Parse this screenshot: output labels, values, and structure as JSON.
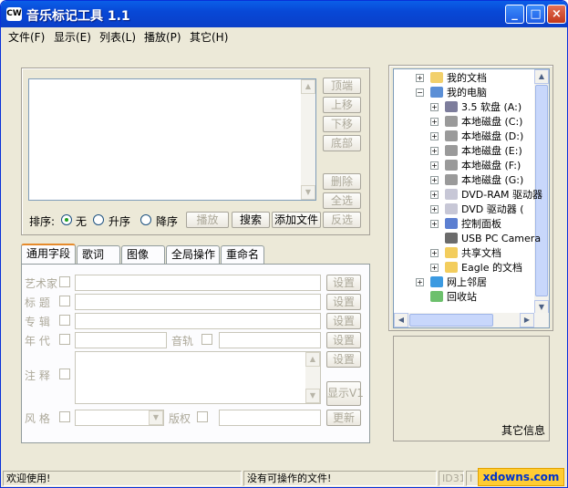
{
  "window": {
    "title": "音乐标记工具 1.1",
    "app_icon_text": "CW"
  },
  "titlebar_buttons": {
    "minimize": "_",
    "maximize": "□",
    "close": "×"
  },
  "menu": [
    "文件(F)",
    "显示(E)",
    "列表(L)",
    "播放(P)",
    "其它(H)"
  ],
  "list_buttons": {
    "top": "顶端",
    "up": "上移",
    "down": "下移",
    "bottom": "底部",
    "delete": "删除",
    "select_all": "全选",
    "invert": "反选"
  },
  "sort": {
    "label": "排序:",
    "none": "无",
    "asc": "升序",
    "desc": "降序",
    "selected": "无"
  },
  "action_buttons": {
    "play": "播放",
    "search": "搜索",
    "add_file": "添加文件"
  },
  "tabs": [
    "通用字段",
    "歌词",
    "图像",
    "全局操作",
    "重命名"
  ],
  "fields": {
    "artist": "艺术家",
    "title": "标 题",
    "album": "专 辑",
    "year": "年 代",
    "track": "音轨",
    "comment": "注 释",
    "genre": "风 格",
    "copyright": "版权"
  },
  "field_buttons": {
    "set": "设置",
    "show": "显示V1",
    "update": "更新"
  },
  "tree": [
    {
      "label": "我的文档",
      "level": 0,
      "expander": "+",
      "icon": "folder-docs-icon"
    },
    {
      "label": "我的电脑",
      "level": 0,
      "expander": "-",
      "icon": "computer-icon"
    },
    {
      "label": "3.5 软盘 (A:)",
      "level": 1,
      "expander": "+",
      "icon": "floppy-icon"
    },
    {
      "label": "本地磁盘 (C:)",
      "level": 1,
      "expander": "+",
      "icon": "disk-icon"
    },
    {
      "label": "本地磁盘 (D:)",
      "level": 1,
      "expander": "+",
      "icon": "disk-icon"
    },
    {
      "label": "本地磁盘 (E:)",
      "level": 1,
      "expander": "+",
      "icon": "disk-icon"
    },
    {
      "label": "本地磁盘 (F:)",
      "level": 1,
      "expander": "+",
      "icon": "disk-icon"
    },
    {
      "label": "本地磁盘 (G:)",
      "level": 1,
      "expander": "+",
      "icon": "disk-icon"
    },
    {
      "label": "DVD-RAM 驱动器",
      "level": 1,
      "expander": "+",
      "icon": "dvd-icon"
    },
    {
      "label": "DVD 驱动器 (",
      "level": 1,
      "expander": "+",
      "icon": "dvd-icon"
    },
    {
      "label": "控制面板",
      "level": 1,
      "expander": "+",
      "icon": "control-panel-icon"
    },
    {
      "label": "USB PC Camera",
      "level": 1,
      "expander": "",
      "icon": "camera-icon"
    },
    {
      "label": "共享文档",
      "level": 1,
      "expander": "+",
      "icon": "folder-icon"
    },
    {
      "label": "Eagle 的文档",
      "level": 1,
      "expander": "+",
      "icon": "folder-icon"
    },
    {
      "label": "网上邻居",
      "level": 0,
      "expander": "+",
      "icon": "network-icon"
    },
    {
      "label": "回收站",
      "level": 0,
      "expander": "",
      "icon": "recycle-bin-icon"
    }
  ],
  "info_panel": {
    "label": "其它信息"
  },
  "status": {
    "welcome": "欢迎使用!",
    "message": "没有可操作的文件!",
    "id3": "ID31",
    "id3b": "I"
  },
  "watermark": "xdowns.com"
}
